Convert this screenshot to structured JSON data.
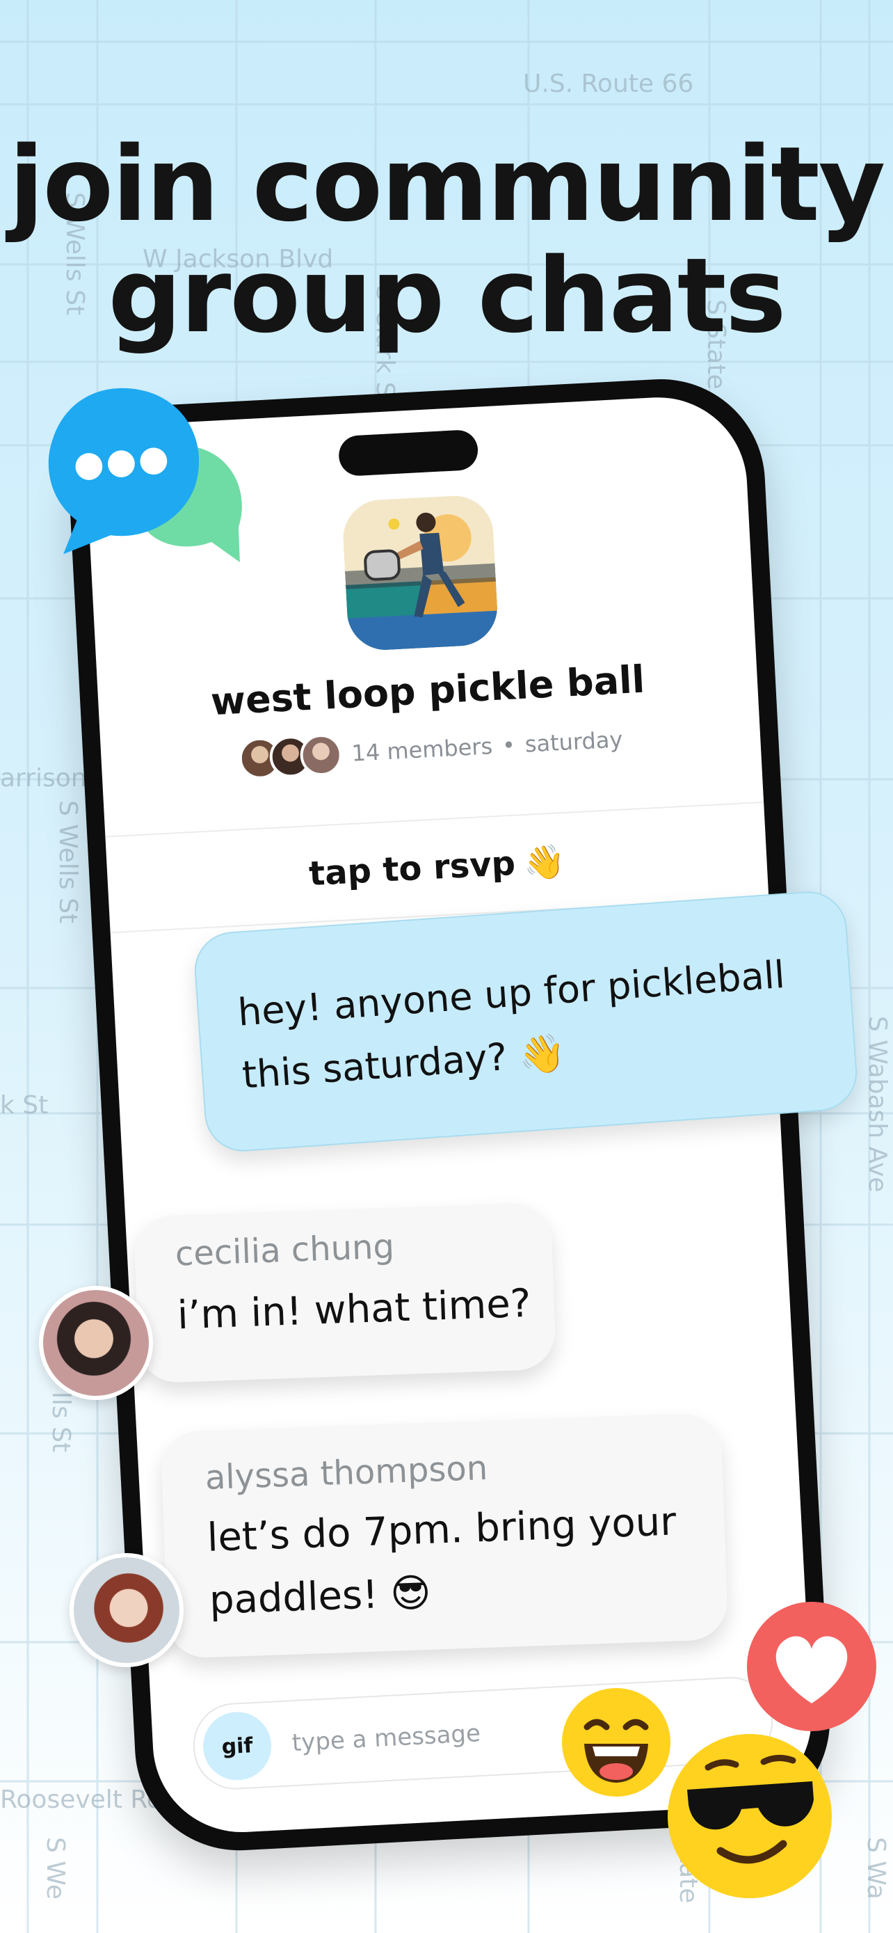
{
  "map": {
    "labels": [
      "U.S. Route 66",
      "W Jackson Blvd",
      "S Wells St",
      "S Clark St",
      "S State",
      "arrison",
      "S Wells St",
      "k St",
      "S Wabash Ave",
      "lls St",
      "Roosevelt Ro",
      "S We",
      "State",
      "S Wa"
    ]
  },
  "headline": {
    "line1": "join community",
    "line2": "group chats"
  },
  "group": {
    "name": "west loop pickle ball",
    "members": "14 members",
    "separator": "•",
    "day": "saturday",
    "image_icon": "pickleball-player-illustration"
  },
  "rsvp": {
    "label": "tap to rsvp",
    "emoji": "👋"
  },
  "messages": [
    {
      "text": "hey! anyone up for pickleball this saturday? 👋"
    },
    {
      "sender": "cecilia chung",
      "text": "i’m in! what time?"
    },
    {
      "sender": "alyssa thompson",
      "text": "let’s do 7pm. bring your paddles! 😎"
    }
  ],
  "composer": {
    "gif_label": "gif",
    "placeholder": "type a message"
  },
  "decorations": {
    "chat_icon": "typing-chat-bubbles-icon",
    "heart_icon": "heart-reaction-icon",
    "laugh_icon": "laughing-emoji-icon",
    "cool_icon": "sunglasses-emoji-icon"
  },
  "colors": {
    "accent_blue": "#c6ecfc",
    "heart_red": "#f2615e",
    "emoji_yellow": "#ffd21f",
    "chat_blue": "#1ea9f1",
    "chat_green": "#6fdca5"
  }
}
